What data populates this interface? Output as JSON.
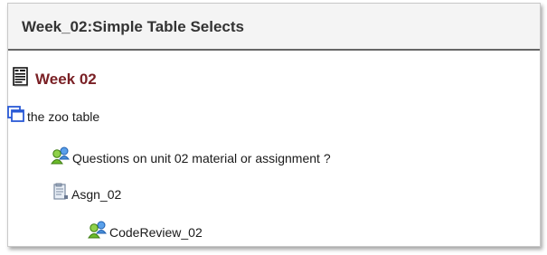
{
  "header": {
    "title": "Week_02:Simple Table Selects"
  },
  "items": [
    {
      "label": "Week 02",
      "icon": "document-icon"
    },
    {
      "label": "the zoo table",
      "icon": "windows-icon"
    },
    {
      "label": "Questions on unit 02 material or assignment ?",
      "icon": "discussion-users-icon"
    },
    {
      "label": "Asgn_02",
      "icon": "assignment-icon"
    },
    {
      "label": "CodeReview_02",
      "icon": "discussion-users-icon"
    }
  ],
  "colors": {
    "week_title": "#7a2025",
    "header_bg": "#f4f4f4",
    "header_rule": "#666666"
  }
}
